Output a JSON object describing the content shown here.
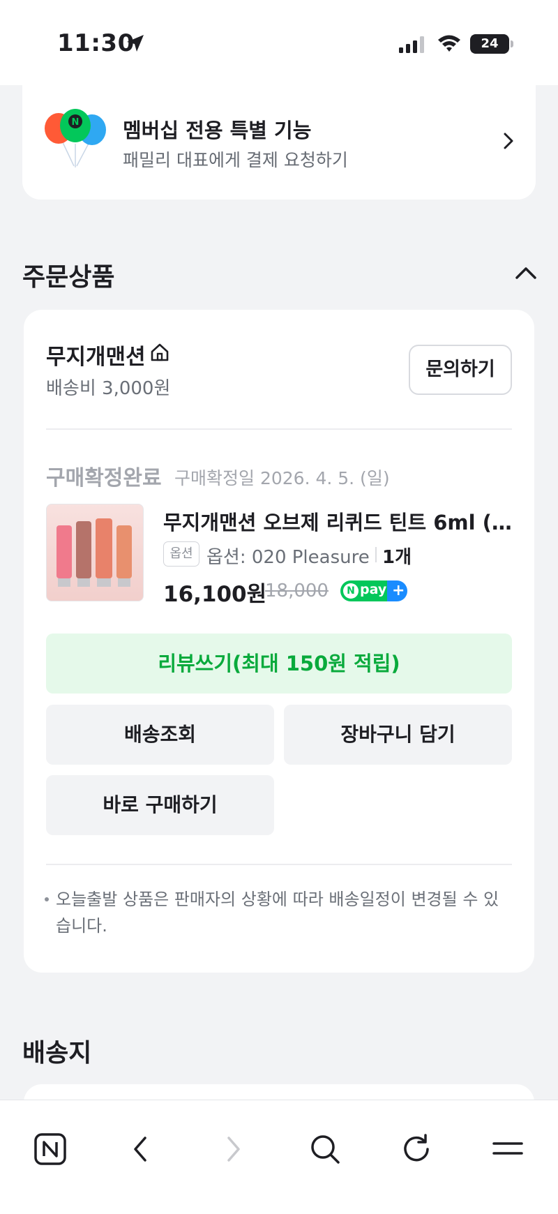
{
  "status_bar": {
    "time": "11:30",
    "battery": "24"
  },
  "membership": {
    "title": "멤버십 전용 특별 기능",
    "subtitle": "패밀리 대표에게 결제 요청하기"
  },
  "order_section": {
    "title": "주문상품",
    "seller": {
      "name": "무지개맨션",
      "shipping_fee": "배송비 3,000원",
      "inquiry_label": "문의하기"
    },
    "item": {
      "status": "구매확정완료",
      "confirm_date": "구매확정일 2026. 4. 5. (일)",
      "name": "무지개맨션 오브제 리퀴드 틴트 6ml (3...",
      "option_badge": "옵션",
      "option": "옵션: 020 Pleasure",
      "quantity": "1개",
      "price": "16,100원",
      "original_price": "18,000",
      "npay_n": "N",
      "npay_label": "pay",
      "npay_plus": "+"
    },
    "buttons": {
      "review": "리뷰쓰기(최대 150원 적립)",
      "track": "배송조회",
      "cart": "장바구니 담기",
      "buy_now": "바로 구매하기"
    },
    "notice": "오늘출발 상품은 판매자의 상황에 따라 배송일정이 변경될 수 있습니다."
  },
  "address_section": {
    "title": "배송지"
  },
  "colors": {
    "naver_green": "#03c75a",
    "review_bg": "#e5f9ea",
    "review_text": "#09aa3c",
    "page_bg": "#f2f3f5"
  },
  "icons": {
    "nav": [
      "naver-home-icon",
      "back-icon",
      "forward-icon",
      "search-icon",
      "reload-icon",
      "menu-icon"
    ]
  }
}
